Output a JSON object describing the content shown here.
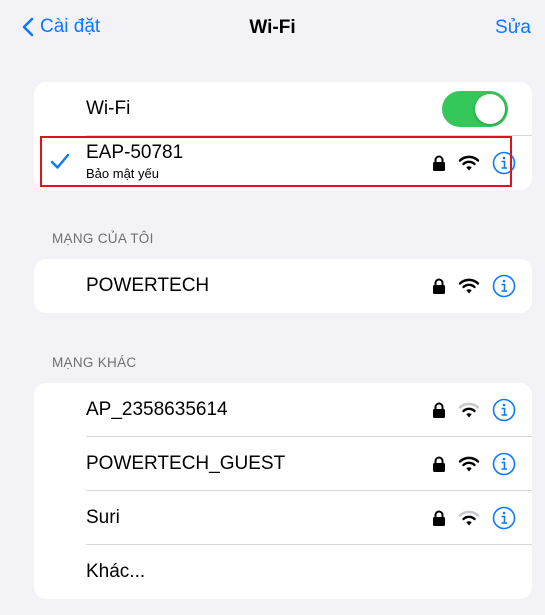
{
  "nav": {
    "back_label": "Cài đặt",
    "title": "Wi-Fi",
    "edit_label": "Sửa"
  },
  "wifi_card": {
    "toggle_label": "Wi-Fi",
    "toggle_on": true,
    "connected": {
      "ssid": "EAP-50781",
      "subtitle": "Bảo mật yếu",
      "secured": true,
      "icons": [
        "checkmark-icon",
        "lock-icon",
        "wifi-icon",
        "info-icon"
      ]
    }
  },
  "my_networks": {
    "header": "MẠNG CỦA TÔI",
    "items": [
      {
        "ssid": "POWERTECH"
      }
    ]
  },
  "other_networks": {
    "header": "MẠNG KHÁC",
    "items": [
      {
        "ssid": "AP_2358635614"
      },
      {
        "ssid": "POWERTECH_GUEST"
      },
      {
        "ssid": "Suri"
      }
    ],
    "other_label": "Khác..."
  },
  "colors": {
    "accent": "#0a7aff",
    "toggle_on": "#34c759",
    "highlight_box": "#e0131a",
    "background": "#f2f2f7"
  }
}
